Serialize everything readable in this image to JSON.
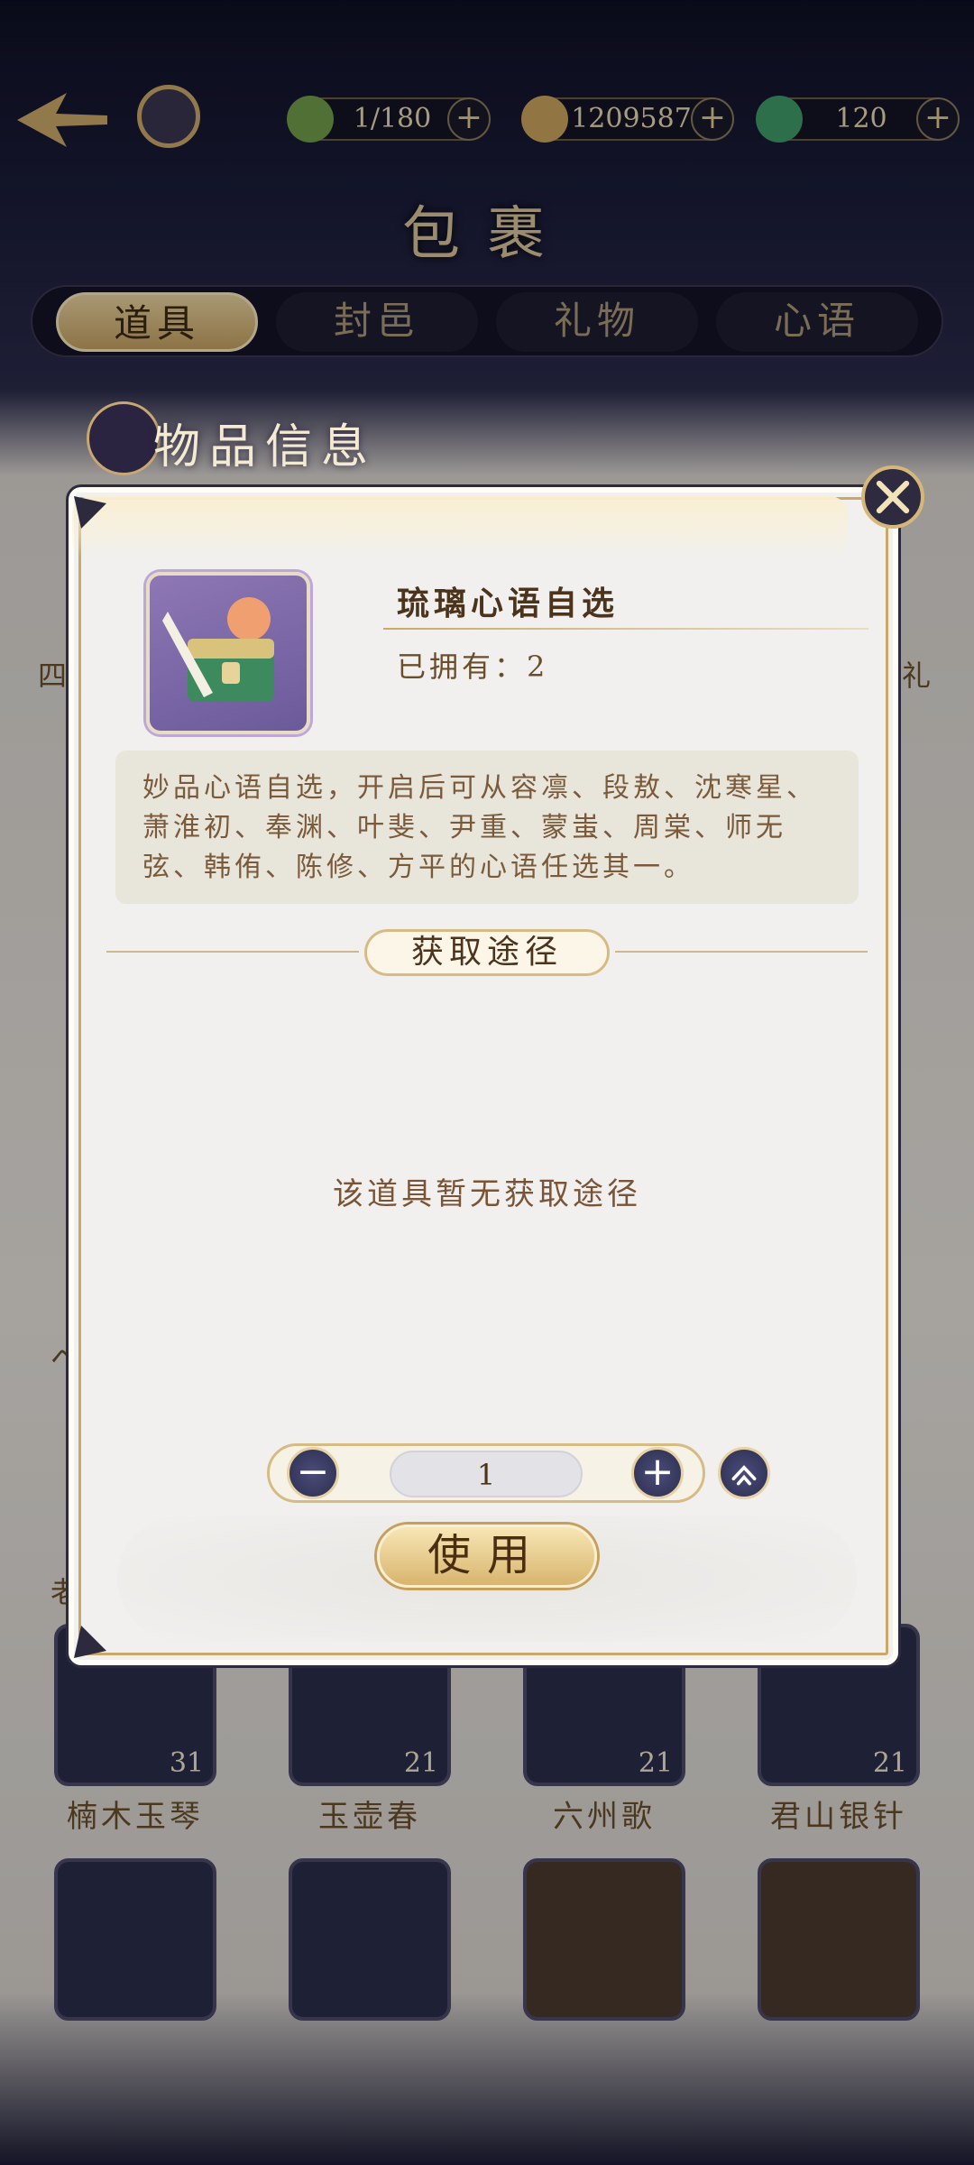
{
  "header": {
    "resources": [
      {
        "icon": "leaf-icon",
        "value": "1/180"
      },
      {
        "icon": "coin-icon",
        "value": "1209587"
      },
      {
        "icon": "jade-icon",
        "value": "120"
      }
    ],
    "plus_symbol": "+",
    "page_title": "包裹"
  },
  "tabs": [
    {
      "label": "道具",
      "active": true
    },
    {
      "label": "封邑",
      "active": false
    },
    {
      "label": "礼物",
      "active": false
    },
    {
      "label": "心语",
      "active": false
    }
  ],
  "grid": {
    "partial_left_labels": [
      "四",
      "ベ",
      "老"
    ],
    "partial_right_label": "礼",
    "items_row": [
      {
        "label": "楠木玉琴",
        "qty": "31"
      },
      {
        "label": "玉壶春",
        "qty": "21"
      },
      {
        "label": "六州歌",
        "qty": "21"
      },
      {
        "label": "君山银针",
        "qty": "21"
      }
    ]
  },
  "modal": {
    "title": "物品信息",
    "item_name": "琉璃心语自选",
    "owned_text": "已拥有：2",
    "description": "妙品心语自选，开启后可从容凛、段敖、沈寒星、萧淮初、奉渊、叶斐、尹重、蒙蚩、周棠、师无弦、韩侑、陈修、方平的心语任选其一。",
    "source_section_title": "获取途径",
    "no_source_text": "该道具暂无获取途径",
    "stepper": {
      "minus": "−",
      "plus": "+",
      "quantity": "1"
    },
    "use_button": "使用"
  },
  "colors": {
    "accent_gold": "#c9a86a",
    "text_brown": "#4b331c",
    "dark_navy": "#2c2d4e"
  }
}
